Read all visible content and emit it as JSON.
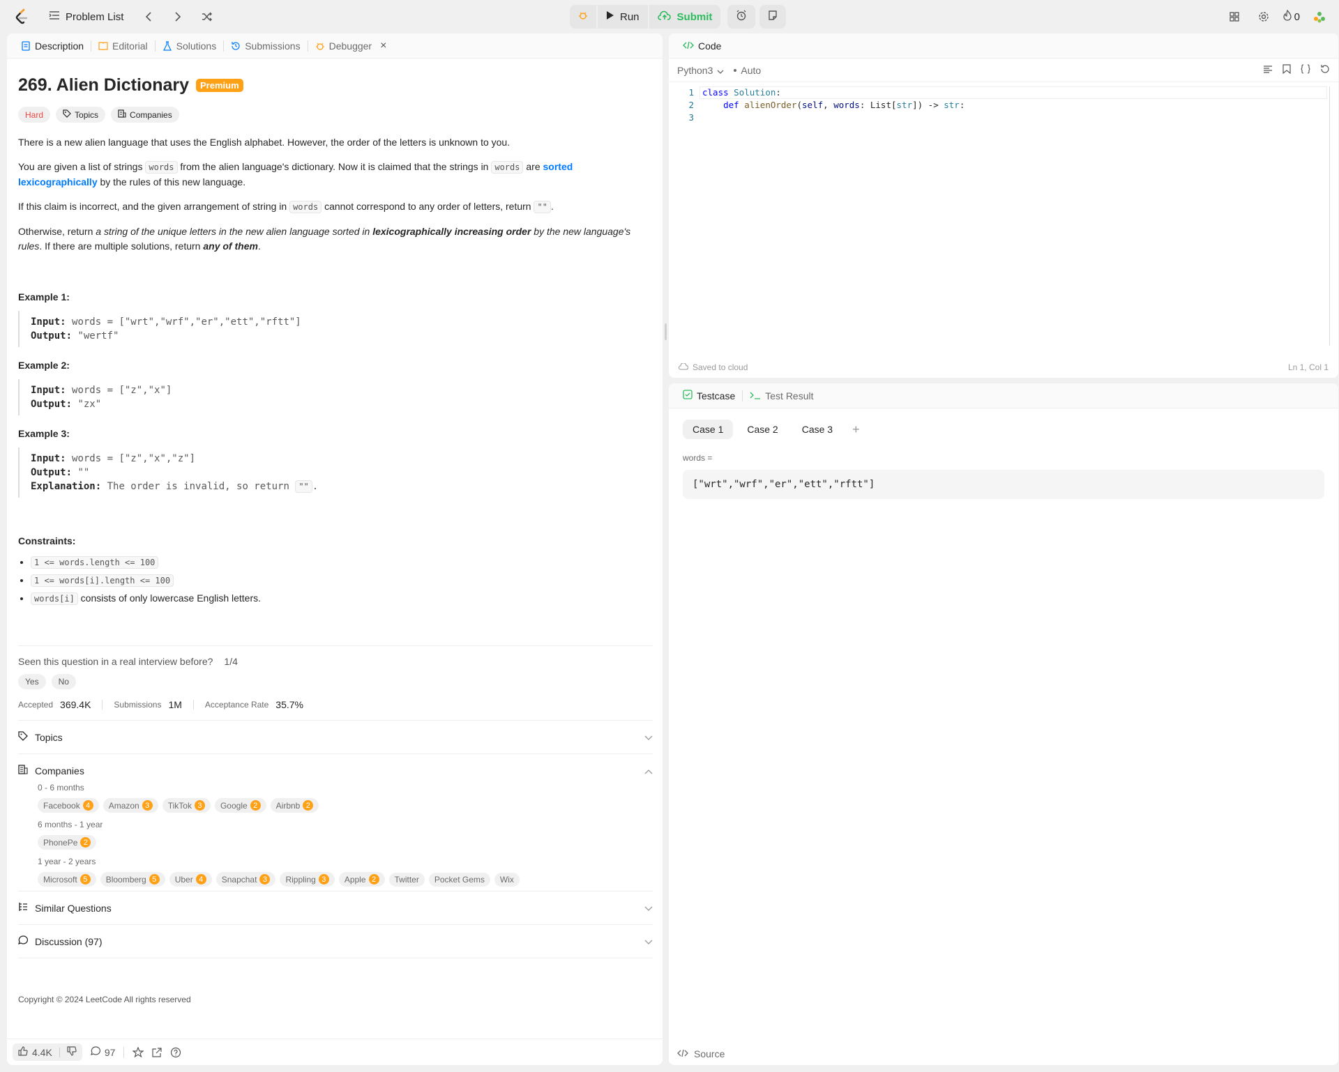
{
  "topbar": {
    "problem_list": "Problem List",
    "run": "Run",
    "submit": "Submit",
    "streak": "0"
  },
  "left_tabs": [
    "Description",
    "Editorial",
    "Solutions",
    "Submissions",
    "Debugger"
  ],
  "problem": {
    "title": "269. Alien Dictionary",
    "premium": "Premium",
    "difficulty": "Hard",
    "topics_chip": "Topics",
    "companies_chip": "Companies",
    "p1": "There is a new alien language that uses the English alphabet. However, the order of the letters is unknown to you.",
    "p2_a": "You are given a list of strings ",
    "p2_code1": "words",
    "p2_b": " from the alien language's dictionary. Now it is claimed that the strings in ",
    "p2_code2": "words",
    "p2_c": " are ",
    "p2_link": "sorted lexicographically",
    "p2_d": " by the rules of this new language.",
    "p3_a": "If this claim is incorrect, and the given arrangement of string in ",
    "p3_code": "words",
    "p3_b": " cannot correspond to any order of letters, return ",
    "p3_code2": "\"\"",
    "p3_c": ".",
    "p4_a": "Otherwise, return ",
    "p4_i": "a string of the unique letters in the new alien language sorted in ",
    "p4_bi": "lexicographically increasing order",
    "p4_i2": " by the new language's rules",
    "p4_b": ". If there are multiple solutions, return ",
    "p4_bi2": "any of them",
    "p4_c": "."
  },
  "examples": [
    {
      "title": "Example 1:",
      "input_label": "Input:",
      "input": "words = [\"wrt\",\"wrf\",\"er\",\"ett\",\"rftt\"]",
      "output_label": "Output:",
      "output": "\"wertf\""
    },
    {
      "title": "Example 2:",
      "input_label": "Input:",
      "input": "words = [\"z\",\"x\"]",
      "output_label": "Output:",
      "output": "\"zx\""
    },
    {
      "title": "Example 3:",
      "input_label": "Input:",
      "input": "words = [\"z\",\"x\",\"z\"]",
      "output_label": "Output:",
      "output": "\"\"",
      "explanation_label": "Explanation:",
      "explanation": "The order is invalid, so return ",
      "explanation_code": "\"\""
    }
  ],
  "constraints": {
    "title": "Constraints:",
    "items": [
      "1 <= words.length <= 100",
      "1 <= words[i].length <= 100"
    ],
    "item3_code": "words[i]",
    "item3_text": " consists of only lowercase English letters."
  },
  "interview": {
    "question": "Seen this question in a real interview before?",
    "count": "1/4",
    "yes": "Yes",
    "no": "No"
  },
  "stats": {
    "accepted_label": "Accepted",
    "accepted": "369.4K",
    "submissions_label": "Submissions",
    "submissions": "1M",
    "rate_label": "Acceptance Rate",
    "rate": "35.7%"
  },
  "sections": {
    "topics": "Topics",
    "companies": "Companies",
    "similar": "Similar Questions",
    "discussion": "Discussion (97)"
  },
  "companies": [
    {
      "period": "0 - 6 months",
      "list": [
        [
          "Facebook",
          "4"
        ],
        [
          "Amazon",
          "3"
        ],
        [
          "TikTok",
          "3"
        ],
        [
          "Google",
          "2"
        ],
        [
          "Airbnb",
          "2"
        ]
      ]
    },
    {
      "period": "6 months - 1 year",
      "list": [
        [
          "PhonePe",
          "2"
        ]
      ]
    },
    {
      "period": "1 year - 2 years",
      "list": [
        [
          "Microsoft",
          "5"
        ],
        [
          "Bloomberg",
          "5"
        ],
        [
          "Uber",
          "4"
        ],
        [
          "Snapchat",
          "3"
        ],
        [
          "Rippling",
          "3"
        ],
        [
          "Apple",
          "2"
        ],
        [
          "Twitter",
          ""
        ],
        [
          "Pocket Gems",
          ""
        ],
        [
          "Wix",
          ""
        ]
      ]
    }
  ],
  "copyright": "Copyright © 2024 LeetCode All rights reserved",
  "bottom": {
    "likes": "4.4K",
    "comments": "97"
  },
  "code": {
    "tab": "Code",
    "language": "Python3",
    "auto": "Auto",
    "lines": [
      "class Solution:",
      "    def alienOrder(self, words: List[str]) -> str:",
      ""
    ],
    "saved": "Saved to cloud",
    "position": "Ln 1, Col 1"
  },
  "tests": {
    "tab_testcase": "Testcase",
    "tab_result": "Test Result",
    "cases": [
      "Case 1",
      "Case 2",
      "Case 3"
    ],
    "var_label": "words =",
    "var_value": "[\"wrt\",\"wrf\",\"er\",\"ett\",\"rftt\"]",
    "source": "Source"
  },
  "colors": {
    "accent": "#ffa116",
    "hard": "#ef4743",
    "link": "#007aff",
    "submit": "#2cbb5d"
  }
}
